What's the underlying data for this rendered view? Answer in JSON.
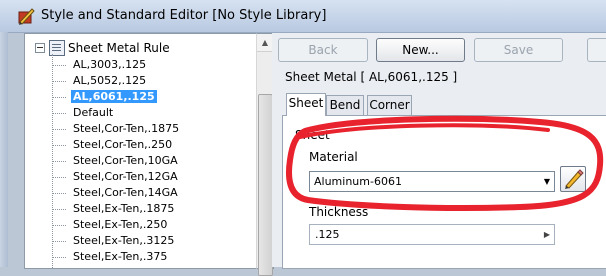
{
  "window": {
    "title": "Style and Standard Editor [No Style Library]"
  },
  "tree": {
    "root_label": "Sheet Metal Rule",
    "items": [
      {
        "label": "AL,3003,.125",
        "selected": false
      },
      {
        "label": "AL,5052,.125",
        "selected": false
      },
      {
        "label": "AL,6061,.125",
        "selected": true
      },
      {
        "label": "Default",
        "selected": false
      },
      {
        "label": "Steel,Cor-Ten,.1875",
        "selected": false
      },
      {
        "label": "Steel,Cor-Ten,.250",
        "selected": false
      },
      {
        "label": "Steel,Cor-Ten,10GA",
        "selected": false
      },
      {
        "label": "Steel,Cor-Ten,12GA",
        "selected": false
      },
      {
        "label": "Steel,Cor-Ten,14GA",
        "selected": false
      },
      {
        "label": "Steel,Ex-Ten,.1875",
        "selected": false
      },
      {
        "label": "Steel,Ex-Ten,.250",
        "selected": false
      },
      {
        "label": "Steel,Ex-Ten,.3125",
        "selected": false
      },
      {
        "label": "Steel,Ex-Ten,.375",
        "selected": false
      }
    ]
  },
  "toolbar": {
    "back_label": "Back",
    "new_label": "New...",
    "save_label": "Save"
  },
  "style_header": "Sheet Metal [ AL,6061,.125 ]",
  "tabs": [
    {
      "label": "Sheet",
      "active": true
    },
    {
      "label": "Bend",
      "active": false
    },
    {
      "label": "Corner",
      "active": false
    }
  ],
  "sheet": {
    "group_label": "Sheet",
    "material_label": "Material",
    "material_value": "Aluminum-6061",
    "thickness_label": "Thickness",
    "thickness_value": ".125"
  },
  "icons": {
    "app": "style-editor-icon",
    "edit_material": "pencil-icon",
    "expander": "tree-collapse-icon",
    "root": "sheet-metal-rule-icon"
  },
  "colors": {
    "selection": "#3399ff",
    "annotation": "#e8232d",
    "titlebar": "#c4d3e8"
  }
}
